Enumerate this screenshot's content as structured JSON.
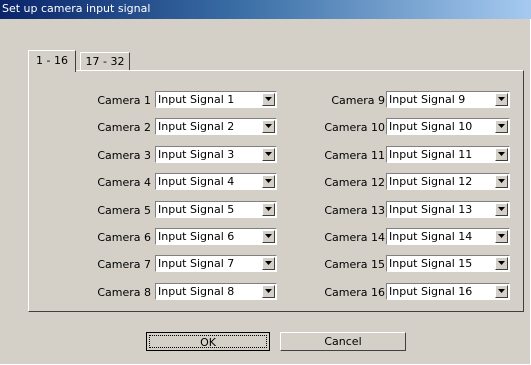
{
  "window": {
    "title": "Set up camera input signal"
  },
  "tabs": [
    {
      "label": "1 - 16",
      "active": true
    },
    {
      "label": "17 - 32",
      "active": false
    }
  ],
  "cameras_left": [
    {
      "label": "Camera 1",
      "value": "Input Signal 1"
    },
    {
      "label": "Camera 2",
      "value": "Input Signal 2"
    },
    {
      "label": "Camera 3",
      "value": "Input Signal 3"
    },
    {
      "label": "Camera 4",
      "value": "Input Signal 4"
    },
    {
      "label": "Camera 5",
      "value": "Input Signal 5"
    },
    {
      "label": "Camera 6",
      "value": "Input Signal 6"
    },
    {
      "label": "Camera 7",
      "value": "Input Signal 7"
    },
    {
      "label": "Camera 8",
      "value": "Input Signal 8"
    }
  ],
  "cameras_right": [
    {
      "label": "Camera 9",
      "value": "Input Signal 9"
    },
    {
      "label": "Camera 10",
      "value": "Input Signal 10"
    },
    {
      "label": "Camera 11",
      "value": "Input Signal 11"
    },
    {
      "label": "Camera 12",
      "value": "Input Signal 12"
    },
    {
      "label": "Camera 13",
      "value": "Input Signal 13"
    },
    {
      "label": "Camera 14",
      "value": "Input Signal 14"
    },
    {
      "label": "Camera 15",
      "value": "Input Signal 15"
    },
    {
      "label": "Camera 16",
      "value": "Input Signal 16"
    }
  ],
  "buttons": {
    "ok": "OK",
    "cancel": "Cancel"
  },
  "colors": {
    "title_start": "#0a246a",
    "title_end": "#a6caf0",
    "face": "#d4d0c8"
  }
}
